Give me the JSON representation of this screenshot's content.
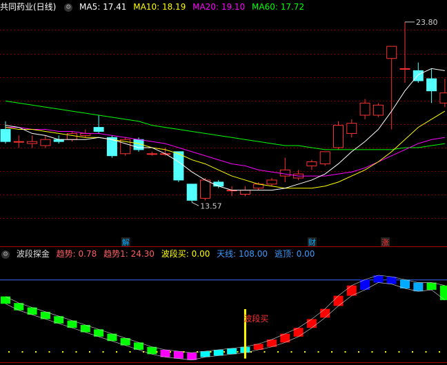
{
  "main_header": {
    "title": "共同药业(日线)",
    "ma5": "MA5: 17.41",
    "ma10": "MA10: 18.19",
    "ma20": "MA20: 19.10",
    "ma60": "MA60: 17.72"
  },
  "indicator_header": {
    "name": "波段探金",
    "trend": "趋势: 0.78",
    "trend1": "趋势1: 24.30",
    "wave_buy": "波段买: 0.00",
    "sky_line": "天线: 108.00",
    "escape_top": "逃顶: 0.00"
  },
  "markers": {
    "jie": "解",
    "cai": "财",
    "zhang": "涨"
  },
  "price_labels": {
    "high": "23.80",
    "low": "13.57"
  },
  "signal_label": "波段买",
  "colors": {
    "up": "#ff3232",
    "down": "#54ffff",
    "ma5": "#ffffff",
    "ma10": "#ffff00",
    "ma20": "#ff00ff",
    "ma60": "#00ff00",
    "grid": "#800000",
    "ind_green": "#00ff00",
    "ind_red": "#ff0000",
    "ind_blue": "#0000ff",
    "ind_magenta": "#ff00ff",
    "ind_cyan": "#00ffff",
    "ind_sky": "#00aaff",
    "sky_line": "#3b6bff"
  },
  "chart_data": [
    {
      "type": "candlestick",
      "candles": [
        {
          "o": 18.5,
          "h": 18.9,
          "l": 17.8,
          "c": 17.9
        },
        {
          "o": 17.9,
          "h": 18.2,
          "l": 17.6,
          "c": 17.9
        },
        {
          "o": 17.8,
          "h": 18.2,
          "l": 17.6,
          "c": 17.9
        },
        {
          "o": 17.7,
          "h": 18.2,
          "l": 17.6,
          "c": 18.0
        },
        {
          "o": 18.0,
          "h": 18.2,
          "l": 17.8,
          "c": 17.9
        },
        {
          "o": 18.0,
          "h": 18.4,
          "l": 17.9,
          "c": 18.3
        },
        {
          "o": 18.2,
          "h": 18.5,
          "l": 18.1,
          "c": 18.3
        },
        {
          "o": 18.6,
          "h": 19.2,
          "l": 18.3,
          "c": 18.4
        },
        {
          "o": 18.1,
          "h": 18.2,
          "l": 17.1,
          "c": 17.2
        },
        {
          "o": 17.3,
          "h": 18.1,
          "l": 17.2,
          "c": 18.0
        },
        {
          "o": 18.0,
          "h": 18.1,
          "l": 17.4,
          "c": 17.5
        },
        {
          "o": 17.3,
          "h": 17.4,
          "l": 17.2,
          "c": 17.3
        },
        {
          "o": 17.3,
          "h": 17.6,
          "l": 17.2,
          "c": 17.3
        },
        {
          "o": 17.4,
          "h": 17.4,
          "l": 15.9,
          "c": 16.0
        },
        {
          "o": 15.8,
          "h": 15.8,
          "l": 14.9,
          "c": 15.0
        },
        {
          "o": 15.1,
          "h": 16.1,
          "l": 15.0,
          "c": 16.0
        },
        {
          "o": 15.9,
          "h": 16.0,
          "l": 15.6,
          "c": 15.7
        },
        {
          "o": 15.5,
          "h": 15.7,
          "l": 15.2,
          "c": 15.5
        },
        {
          "o": 15.3,
          "h": 15.7,
          "l": 15.2,
          "c": 15.5
        },
        {
          "o": 15.6,
          "h": 15.9,
          "l": 15.5,
          "c": 15.8
        },
        {
          "o": 15.8,
          "h": 16.1,
          "l": 15.7,
          "c": 16.0
        },
        {
          "o": 16.2,
          "h": 17.1,
          "l": 15.9,
          "c": 16.5
        },
        {
          "o": 16.1,
          "h": 16.5,
          "l": 16.0,
          "c": 16.3
        },
        {
          "o": 16.7,
          "h": 17.0,
          "l": 16.5,
          "c": 16.9
        },
        {
          "o": 16.8,
          "h": 17.4,
          "l": 16.7,
          "c": 17.4
        },
        {
          "o": 17.6,
          "h": 18.9,
          "l": 17.5,
          "c": 18.7
        },
        {
          "o": 18.3,
          "h": 19.0,
          "l": 18.1,
          "c": 18.8
        },
        {
          "o": 19.2,
          "h": 20.0,
          "l": 19.0,
          "c": 19.8
        },
        {
          "o": 19.2,
          "h": 19.8,
          "l": 19.1,
          "c": 19.7
        },
        {
          "o": 22.0,
          "h": 22.6,
          "l": 18.5,
          "c": 22.6
        },
        {
          "o": 21.5,
          "h": 23.8,
          "l": 20.8,
          "c": 21.5
        },
        {
          "o": 21.4,
          "h": 21.8,
          "l": 20.8,
          "c": 20.9
        },
        {
          "o": 21.0,
          "h": 21.5,
          "l": 19.8,
          "c": 20.4
        },
        {
          "o": 19.8,
          "h": 21.0,
          "l": 19.6,
          "c": 20.3
        }
      ],
      "ma5": [
        18.7,
        18.6,
        18.3,
        18.2,
        18.0,
        18.0,
        18.0,
        18.1,
        18.0,
        17.8,
        17.6,
        17.6,
        17.3,
        16.9,
        16.4,
        16.0,
        15.7,
        15.5,
        15.5,
        15.5,
        15.5,
        15.6,
        15.8,
        16.0,
        16.3,
        16.8,
        17.4,
        17.9,
        18.5,
        19.4,
        20.4,
        21.2,
        21.5,
        21.4
      ],
      "ma10": [
        18.6,
        18.5,
        18.5,
        18.4,
        18.3,
        18.2,
        18.1,
        18.1,
        18.0,
        17.9,
        17.8,
        17.6,
        17.5,
        17.3,
        17.0,
        16.8,
        16.5,
        16.2,
        16.0,
        15.8,
        15.7,
        15.6,
        15.6,
        15.6,
        15.7,
        15.9,
        16.2,
        16.5,
        16.9,
        17.4,
        18.0,
        18.6,
        19.0,
        19.4
      ],
      "ma20": [
        18.6,
        18.6,
        18.5,
        18.5,
        18.4,
        18.4,
        18.3,
        18.3,
        18.2,
        18.1,
        18.0,
        17.9,
        17.8,
        17.6,
        17.4,
        17.2,
        17.0,
        16.8,
        16.7,
        16.5,
        16.4,
        16.3,
        16.2,
        16.2,
        16.2,
        16.3,
        16.4,
        16.6,
        16.9,
        17.2,
        17.5,
        17.8,
        18.0,
        18.1
      ],
      "ma60": [
        19.9,
        19.8,
        19.7,
        19.6,
        19.5,
        19.4,
        19.3,
        19.2,
        19.1,
        19.0,
        18.9,
        18.7,
        18.6,
        18.5,
        18.4,
        18.3,
        18.2,
        18.1,
        18.0,
        17.9,
        17.8,
        17.7,
        17.7,
        17.6,
        17.5,
        17.5,
        17.5,
        17.5,
        17.5,
        17.5,
        17.6,
        17.6,
        17.7,
        17.8
      ],
      "ylim": [
        12.9,
        24.0
      ]
    },
    {
      "type": "bar",
      "name": "波段探金",
      "series": [
        {
          "name": "趋势",
          "values": [
            [
              85,
              75
            ],
            [
              76,
              66
            ],
            [
              70,
              60
            ],
            [
              64,
              54
            ],
            [
              58,
              48
            ],
            [
              52,
              42
            ],
            [
              46,
              36
            ],
            [
              40,
              30
            ],
            [
              34,
              24
            ],
            [
              28,
              18
            ],
            [
              22,
              12
            ],
            [
              16,
              6
            ],
            [
              12,
              2
            ],
            [
              10,
              0
            ],
            [
              8,
              -2
            ],
            [
              10,
              2
            ],
            [
              12,
              4
            ],
            [
              14,
              6
            ],
            [
              16,
              8
            ],
            [
              20,
              12
            ],
            [
              26,
              16
            ],
            [
              34,
              22
            ],
            [
              42,
              30
            ],
            [
              54,
              42
            ],
            [
              68,
              56
            ],
            [
              86,
              72
            ],
            [
              100,
              86
            ],
            [
              108,
              94
            ],
            [
              114,
              104
            ],
            [
              112,
              102
            ],
            [
              108,
              96
            ],
            [
              104,
              92
            ],
            [
              104,
              94
            ],
            [
              100,
              80
            ]
          ]
        },
        {
          "name": "color",
          "values": [
            "green",
            "green",
            "green",
            "green",
            "green",
            "green",
            "green",
            "green",
            "green",
            "green",
            "green",
            "green",
            "magenta",
            "magenta",
            "magenta",
            "cyan",
            "cyan",
            "cyan",
            "cyan",
            "red",
            "red",
            "red",
            "red",
            "red",
            "red",
            "red",
            "red",
            "blue",
            "blue",
            "blue",
            "sky",
            "sky",
            "green",
            "green"
          ]
        }
      ],
      "sky_line": 108,
      "ylim": [
        -6,
        130
      ]
    }
  ]
}
